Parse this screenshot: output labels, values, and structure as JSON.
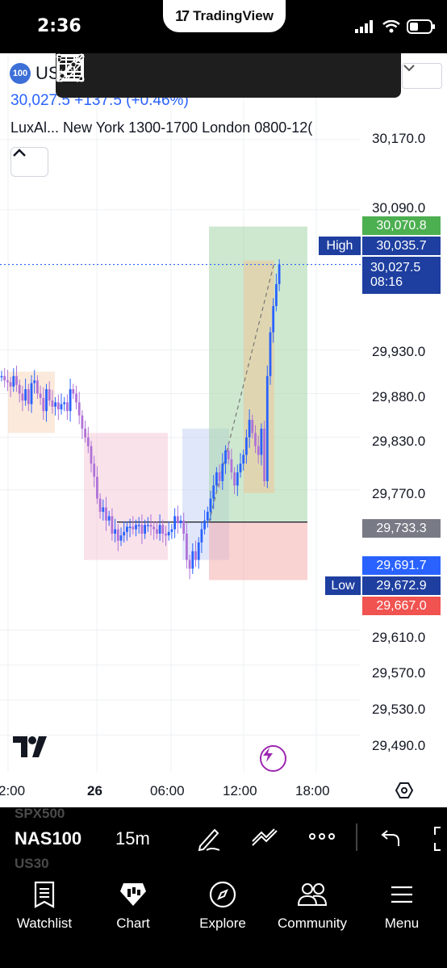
{
  "status": {
    "time": "2:36",
    "pill_brand": "TradingView"
  },
  "header": {
    "symbol_badge": "100",
    "symbol_name": "US",
    "price_line": "30,027.5 +137.5 (+0.46%)",
    "indicator": "LuxAl... New York 1300-1700 London 0800-12("
  },
  "draw_tools": [
    "rectangle-tool",
    "horizontal-line-l-tool",
    "horizontal-line-s-tool",
    "grid-tool",
    "trend-line-tool",
    "brush-tool",
    "ray-line-tool"
  ],
  "price_axis": {
    "ticks": [
      "30,170.0",
      "30,090.0",
      "29,930.0",
      "29,880.0",
      "29,830.0",
      "29,770.0",
      "29,610.0",
      "29,570.0",
      "29,530.0",
      "29,490.0"
    ],
    "tags": {
      "target": "30,070.8",
      "high": "30,035.7",
      "last": "30,027.5",
      "countdown": "08:16",
      "entry": "29,733.3",
      "blue1": "29,691.7",
      "low": "29,672.9",
      "stop": "29,667.0"
    },
    "high_label": "High",
    "low_label": "Low"
  },
  "time_axis": [
    "2:00",
    "26",
    "06:00",
    "12:00",
    "18:00"
  ],
  "switcher": {
    "prev_symbol": "SPX500",
    "current_symbol": "NAS100",
    "next_symbol": "US30",
    "interval": "15m"
  },
  "nav": [
    {
      "label": "Watchlist",
      "icon": "watchlist-icon"
    },
    {
      "label": "Chart",
      "icon": "chart-icon"
    },
    {
      "label": "Explore",
      "icon": "compass-icon"
    },
    {
      "label": "Community",
      "icon": "community-icon"
    },
    {
      "label": "Menu",
      "icon": "menu-icon"
    }
  ],
  "colors": {
    "up": "#2962ff",
    "down": "#b072d8",
    "target": "#4caf50",
    "stop": "#f05350",
    "tag_blue": "#1e3fa0",
    "entry_grey": "#777777"
  },
  "chart_data": {
    "type": "candlestick",
    "ylim": [
      29470,
      30190
    ],
    "y_ticks": [
      30170,
      30090,
      29930,
      29880,
      29830,
      29770,
      29610,
      29570,
      29530,
      29490
    ],
    "x_ticks": [
      "2:00",
      "26",
      "06:00",
      "12:00",
      "18:00"
    ],
    "last_price": 30027.5,
    "high": 30035.7,
    "low": 29672.9,
    "close_series": [
      29900,
      29895,
      29893,
      29888,
      29900,
      29890,
      29880,
      29872,
      29885,
      29868,
      29892,
      29895,
      29880,
      29875,
      29860,
      29885,
      29872,
      29865,
      29870,
      29862,
      29868,
      29870,
      29860,
      29885,
      29880,
      29870,
      29855,
      29840,
      29830,
      29820,
      29800,
      29785,
      29760,
      29745,
      29750,
      29735,
      29740,
      29720,
      29725,
      29712,
      29718,
      29722,
      29728,
      29728,
      29725,
      29730,
      29730,
      29720,
      29730,
      29730,
      29728,
      29725,
      29720,
      29730,
      29720,
      29718,
      29722,
      29725,
      29740,
      29732,
      29735,
      29720,
      29690,
      29680,
      29700,
      29690,
      29710,
      29725,
      29735,
      29745,
      29760,
      29775,
      29790,
      29780,
      29800,
      29815,
      29805,
      29790,
      29775,
      29790,
      29800,
      29810,
      29830,
      29850,
      29835,
      29820,
      29810,
      29840,
      29780,
      29900,
      29950,
      29980,
      30005,
      30027.5
    ],
    "position": {
      "target": 30070.8,
      "entry": 29733.3,
      "stop": 29667.0
    }
  }
}
